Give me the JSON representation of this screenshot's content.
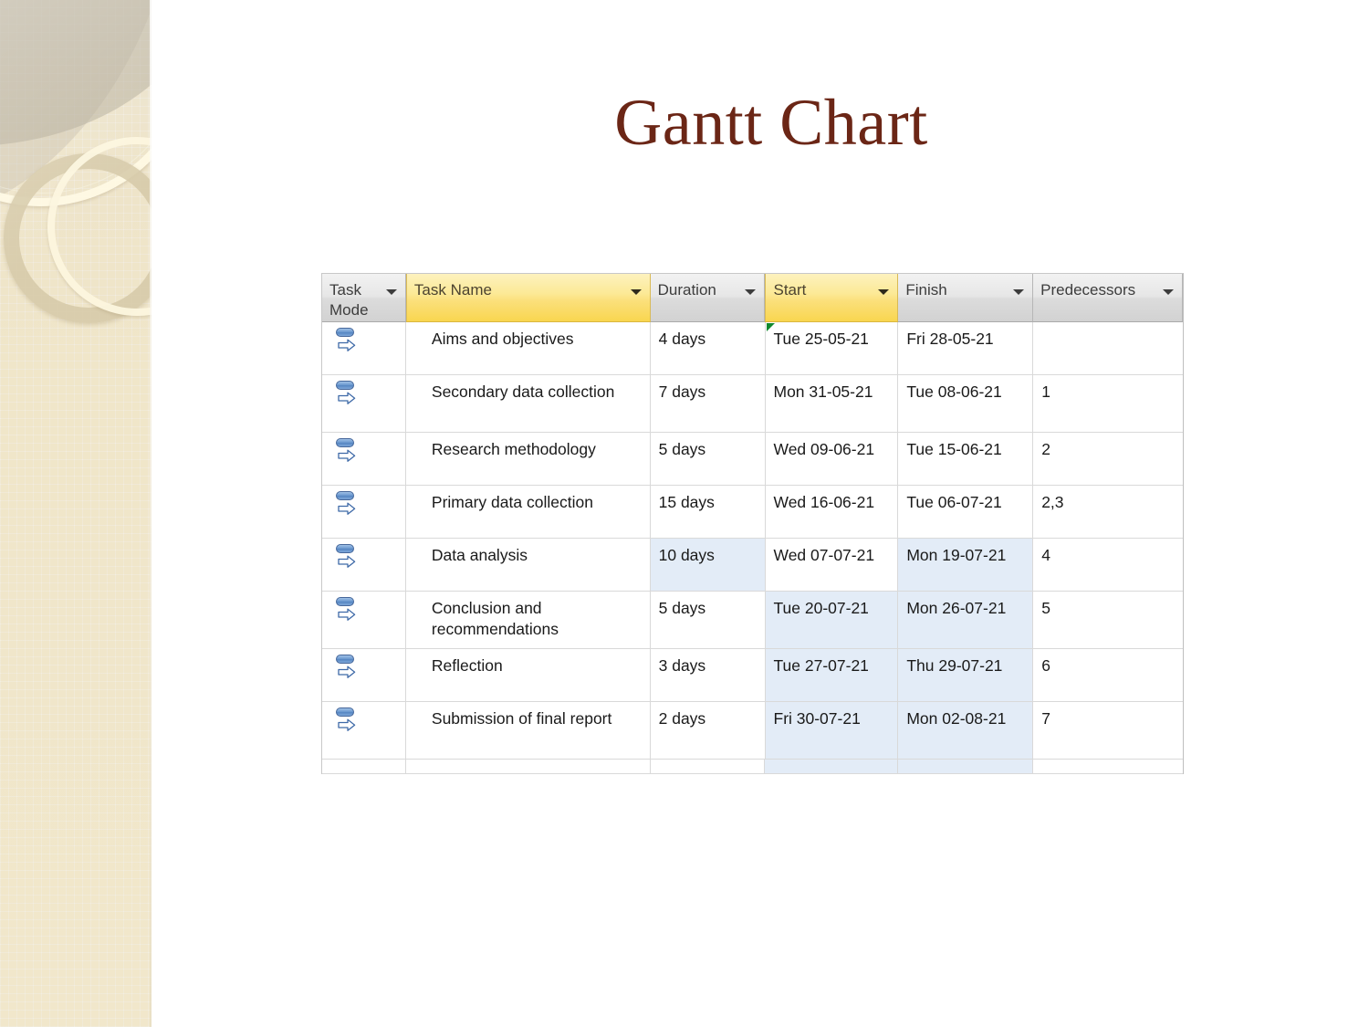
{
  "slide": {
    "title": "Gantt Chart",
    "title_color": "#6b2616",
    "background_color": "#ffffff",
    "decor_band_color": "#f0e6c9"
  },
  "table": {
    "header_accent_color": "#fbe07c",
    "header_base_color": "#dcdcdc",
    "selection_color": "#e3ecf7",
    "columns": [
      {
        "key": "mode",
        "label": "Task\nMode",
        "highlighted": false,
        "has_filter": true
      },
      {
        "key": "name",
        "label": "Task Name",
        "highlighted": true,
        "has_filter": true
      },
      {
        "key": "dur",
        "label": "Duration",
        "highlighted": false,
        "has_filter": true
      },
      {
        "key": "start",
        "label": "Start",
        "highlighted": true,
        "has_filter": true
      },
      {
        "key": "fin",
        "label": "Finish",
        "highlighted": false,
        "has_filter": true
      },
      {
        "key": "pred",
        "label": "Predecessors",
        "highlighted": false,
        "has_filter": true
      }
    ],
    "rows": [
      {
        "task_mode": "auto-scheduled",
        "name": "Aims and objectives",
        "duration": "4 days",
        "start": "Tue 25-05-21",
        "finish": "Fri 28-05-21",
        "predecessors": "",
        "start_flag": true,
        "shaded": {
          "dur": false,
          "start": false,
          "fin": false
        },
        "lines": 1
      },
      {
        "task_mode": "auto-scheduled",
        "name": "Secondary data collection",
        "duration": "7 days",
        "start": "Mon 31-05-21",
        "finish": "Tue 08-06-21",
        "predecessors": "1",
        "start_flag": false,
        "shaded": {
          "dur": false,
          "start": false,
          "fin": false
        },
        "lines": 2
      },
      {
        "task_mode": "auto-scheduled",
        "name": "Research methodology",
        "duration": "5 days",
        "start": "Wed 09-06-21",
        "finish": "Tue 15-06-21",
        "predecessors": "2",
        "start_flag": false,
        "shaded": {
          "dur": false,
          "start": false,
          "fin": false
        },
        "lines": 1
      },
      {
        "task_mode": "auto-scheduled",
        "name": "Primary data collection",
        "duration": "15 days",
        "start": "Wed 16-06-21",
        "finish": "Tue 06-07-21",
        "predecessors": "2,3",
        "start_flag": false,
        "shaded": {
          "dur": false,
          "start": false,
          "fin": false
        },
        "lines": 1
      },
      {
        "task_mode": "auto-scheduled",
        "name": "Data analysis",
        "duration": "10 days",
        "start": "Wed 07-07-21",
        "finish": "Mon 19-07-21",
        "predecessors": "4",
        "start_flag": false,
        "shaded": {
          "dur": true,
          "start": false,
          "fin": true
        },
        "lines": 1
      },
      {
        "task_mode": "auto-scheduled",
        "name": "Conclusion and recommendations",
        "duration": "5 days",
        "start": "Tue 20-07-21",
        "finish": "Mon 26-07-21",
        "predecessors": "5",
        "start_flag": false,
        "shaded": {
          "dur": false,
          "start": true,
          "fin": true
        },
        "lines": 2
      },
      {
        "task_mode": "auto-scheduled",
        "name": "Reflection",
        "duration": "3 days",
        "start": "Tue 27-07-21",
        "finish": "Thu 29-07-21",
        "predecessors": "6",
        "start_flag": false,
        "shaded": {
          "dur": false,
          "start": true,
          "fin": true
        },
        "lines": 1
      },
      {
        "task_mode": "auto-scheduled",
        "name": "Submission of final report",
        "duration": "2 days",
        "start": "Fri 30-07-21",
        "finish": "Mon 02-08-21",
        "predecessors": "7",
        "start_flag": false,
        "shaded": {
          "dur": false,
          "start": true,
          "fin": true
        },
        "lines": 2
      }
    ],
    "filler_row": {
      "shaded": {
        "dur": false,
        "start": true,
        "fin": true
      }
    }
  }
}
